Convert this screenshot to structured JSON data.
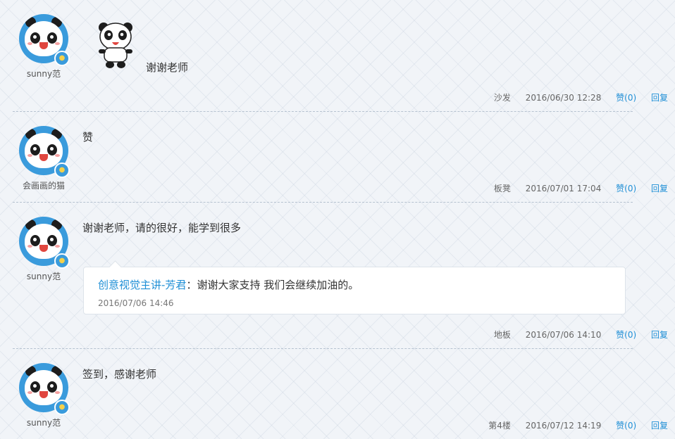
{
  "comments": [
    {
      "username": "sunny范",
      "text": "谢谢老师",
      "floor": "沙发",
      "time": "2016/06/30 12:28",
      "like": "赞(0)",
      "reply": "回复",
      "has_sticker": true
    },
    {
      "username": "会画画的猫",
      "text": "赞",
      "floor": "板凳",
      "time": "2016/07/01 17:04",
      "like": "赞(0)",
      "reply": "回复"
    },
    {
      "username": "sunny范",
      "text": "谢谢老师，请的很好，能学到很多",
      "floor": "地板",
      "time": "2016/07/06 14:10",
      "like": "赞(0)",
      "reply": "回复",
      "author_reply": {
        "author": "创意视觉主讲-芳君",
        "separator": "：",
        "text": "谢谢大家支持 我们会继续加油的。",
        "time": "2016/07/06 14:46"
      }
    },
    {
      "username": "sunny范",
      "text": "签到，感谢老师",
      "floor": "第4楼",
      "time": "2016/07/12 14:19",
      "like": "赞(0)",
      "reply": "回复"
    }
  ],
  "icons": {
    "avatar": "panda-avatar-icon",
    "badge": "vip-tshirt-badge-icon",
    "sticker": "panda-sticker-icon"
  },
  "colors": {
    "link": "#1f8fd6",
    "avatar_bg": "#3a9bdc"
  }
}
